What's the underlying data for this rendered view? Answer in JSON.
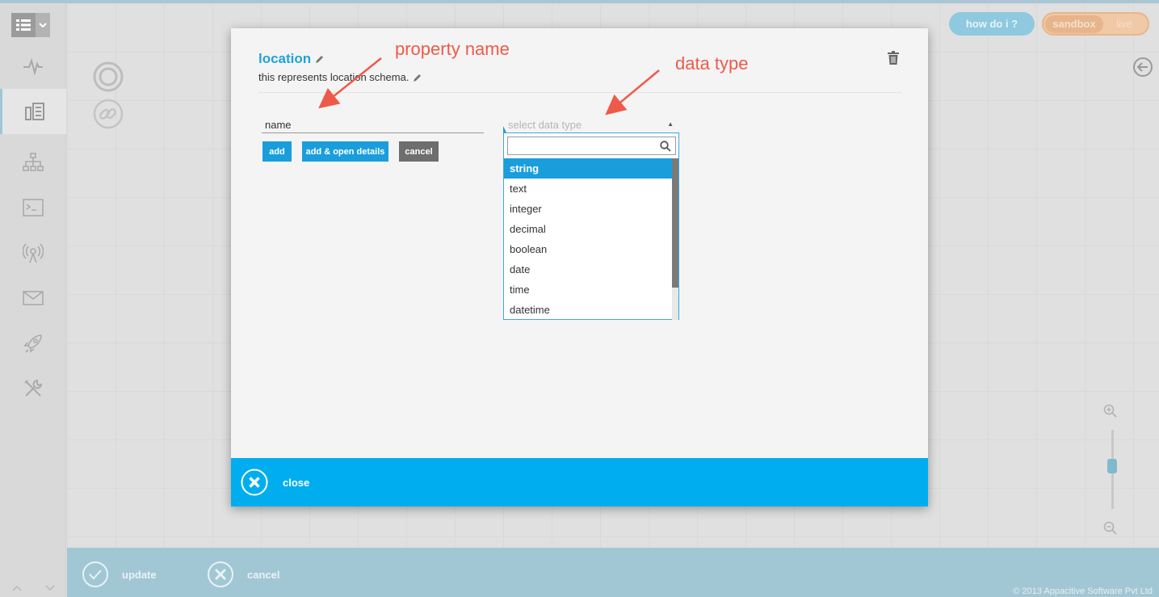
{
  "header": {
    "how_do_i_label": "how do i ?",
    "env_sandbox_label": "sandbox",
    "env_live_label": "live"
  },
  "sidebar": {
    "items": [
      {
        "icon": "pulse-icon"
      },
      {
        "icon": "schema-icon"
      },
      {
        "icon": "hierarchy-icon"
      },
      {
        "icon": "terminal-icon"
      },
      {
        "icon": "broadcast-icon"
      },
      {
        "icon": "mail-icon"
      },
      {
        "icon": "rocket-icon"
      },
      {
        "icon": "tools-icon"
      }
    ]
  },
  "modal": {
    "title": "location",
    "description": "this represents location schema.",
    "property_name_value": "name",
    "add_label": "add",
    "add_open_label": "add & open details",
    "cancel_label": "cancel",
    "data_type_placeholder": "select data type",
    "data_types": [
      "string",
      "text",
      "integer",
      "decimal",
      "boolean",
      "date",
      "time",
      "datetime"
    ],
    "selected_data_type": "string",
    "close_label": "close"
  },
  "annotations": {
    "property_name": "property name",
    "data_type": "data type"
  },
  "bottom_bar": {
    "update_label": "update",
    "cancel_label": "cancel",
    "copyright": "© 2013 Appacitive Software Pvt Ltd"
  },
  "colors": {
    "accent": "#1a9edb",
    "footer": "#00aeef",
    "annotation": "#ee5a4a",
    "bottom_bar": "#a2c7d4"
  }
}
